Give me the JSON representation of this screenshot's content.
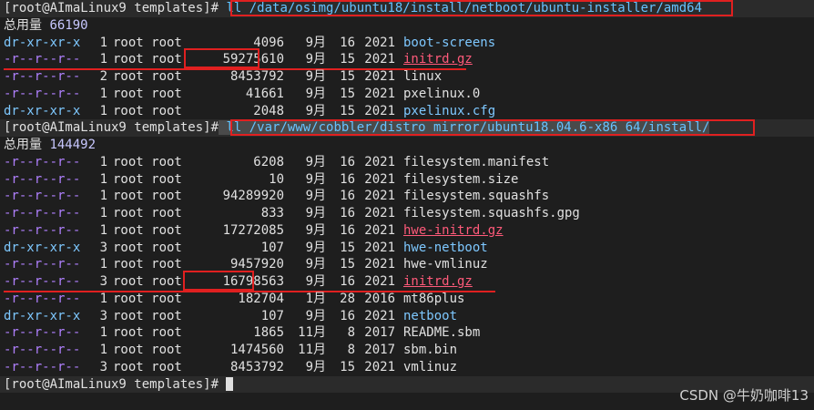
{
  "prompt": "[root@AImaLinux9 templates]#",
  "blocks": [
    {
      "command": "ll /data/osimg/ubuntu18/install/netboot/ubuntu-installer/amd64",
      "total_label": "总用量",
      "total_value": "66190",
      "rows": [
        {
          "perm": "dr-xr-xr-x",
          "links": "1",
          "owner": "root root",
          "size": "4096",
          "month": "9月",
          "day": "16",
          "year": "2021",
          "name": "boot-screens",
          "kind": "dir"
        },
        {
          "perm": "-r--r--r--",
          "links": "1",
          "owner": "root root",
          "size": "59275610",
          "month": "9月",
          "day": "15",
          "year": "2021",
          "name": "initrd.gz",
          "kind": "arc"
        },
        {
          "perm": "-r--r--r--",
          "links": "2",
          "owner": "root root",
          "size": "8453792",
          "month": "9月",
          "day": "15",
          "year": "2021",
          "name": "linux",
          "kind": "file"
        },
        {
          "perm": "-r--r--r--",
          "links": "1",
          "owner": "root root",
          "size": "41661",
          "month": "9月",
          "day": "15",
          "year": "2021",
          "name": "pxelinux.0",
          "kind": "file"
        },
        {
          "perm": "dr-xr-xr-x",
          "links": "1",
          "owner": "root root",
          "size": "2048",
          "month": "9月",
          "day": "15",
          "year": "2021",
          "name": "pxelinux.cfg",
          "kind": "dir"
        }
      ]
    },
    {
      "command": "ll /var/www/cobbler/distro_mirror/ubuntu18.04.6-x86_64/install/",
      "total_label": "总用量",
      "total_value": "144492",
      "rows": [
        {
          "perm": "-r--r--r--",
          "links": "1",
          "owner": "root root",
          "size": "6208",
          "month": "9月",
          "day": "16",
          "year": "2021",
          "name": "filesystem.manifest",
          "kind": "file"
        },
        {
          "perm": "-r--r--r--",
          "links": "1",
          "owner": "root root",
          "size": "10",
          "month": "9月",
          "day": "16",
          "year": "2021",
          "name": "filesystem.size",
          "kind": "file"
        },
        {
          "perm": "-r--r--r--",
          "links": "1",
          "owner": "root root",
          "size": "94289920",
          "month": "9月",
          "day": "16",
          "year": "2021",
          "name": "filesystem.squashfs",
          "kind": "file"
        },
        {
          "perm": "-r--r--r--",
          "links": "1",
          "owner": "root root",
          "size": "833",
          "month": "9月",
          "day": "16",
          "year": "2021",
          "name": "filesystem.squashfs.gpg",
          "kind": "file"
        },
        {
          "perm": "-r--r--r--",
          "links": "1",
          "owner": "root root",
          "size": "17272085",
          "month": "9月",
          "day": "16",
          "year": "2021",
          "name": "hwe-initrd.gz",
          "kind": "arc"
        },
        {
          "perm": "dr-xr-xr-x",
          "links": "3",
          "owner": "root root",
          "size": "107",
          "month": "9月",
          "day": "15",
          "year": "2021",
          "name": "hwe-netboot",
          "kind": "dir"
        },
        {
          "perm": "-r--r--r--",
          "links": "1",
          "owner": "root root",
          "size": "9457920",
          "month": "9月",
          "day": "15",
          "year": "2021",
          "name": "hwe-vmlinuz",
          "kind": "file"
        },
        {
          "perm": "-r--r--r--",
          "links": "3",
          "owner": "root root",
          "size": "16798563",
          "month": "9月",
          "day": "16",
          "year": "2021",
          "name": "initrd.gz",
          "kind": "arc"
        },
        {
          "perm": "-r--r--r--",
          "links": "1",
          "owner": "root root",
          "size": "182704",
          "month": "1月",
          "day": "28",
          "year": "2016",
          "name": "mt86plus",
          "kind": "file"
        },
        {
          "perm": "dr-xr-xr-x",
          "links": "3",
          "owner": "root root",
          "size": "107",
          "month": "9月",
          "day": "16",
          "year": "2021",
          "name": "netboot",
          "kind": "dir"
        },
        {
          "perm": "-r--r--r--",
          "links": "1",
          "owner": "root root",
          "size": "1865",
          "month": "11月",
          "day": "8",
          "year": "2017",
          "name": "README.sbm",
          "kind": "file"
        },
        {
          "perm": "-r--r--r--",
          "links": "1",
          "owner": "root root",
          "size": "1474560",
          "month": "11月",
          "day": "8",
          "year": "2017",
          "name": "sbm.bin",
          "kind": "file"
        },
        {
          "perm": "-r--r--r--",
          "links": "3",
          "owner": "root root",
          "size": "8453792",
          "month": "9月",
          "day": "15",
          "year": "2021",
          "name": "vmlinuz",
          "kind": "file"
        }
      ]
    }
  ],
  "watermark": "CSDN @牛奶咖啡13"
}
